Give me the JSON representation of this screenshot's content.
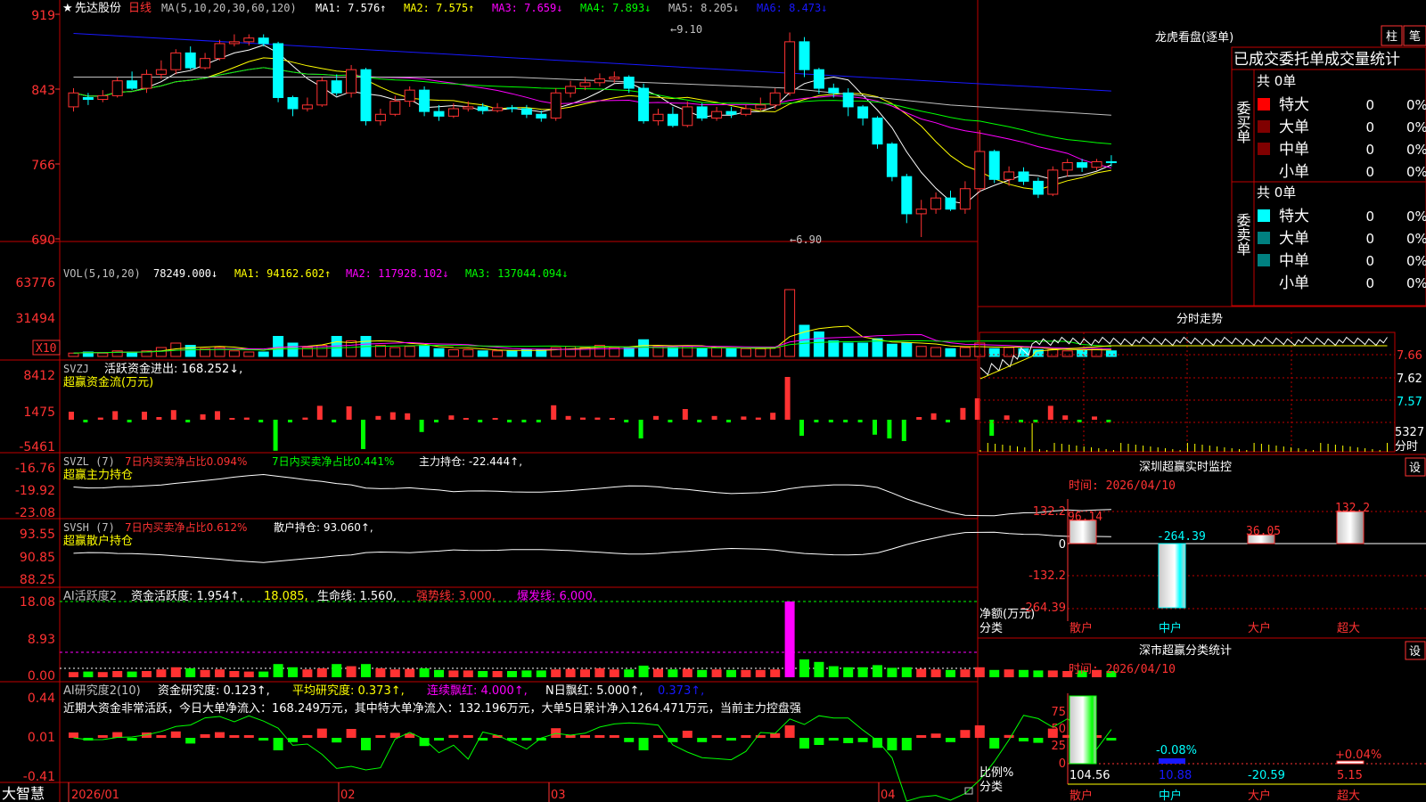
{
  "colors": {
    "up": "#ff3232",
    "down": "#00ffff",
    "ma1": "#ffffff",
    "ma2": "#ffff00",
    "ma3": "#ff00ff",
    "ma4": "#00ff00",
    "ma5": "#c0c0c0",
    "ma6": "#1818ff",
    "grid": "#c00000",
    "label": "#ff3232",
    "white": "#ffffff",
    "yellow": "#ffff00"
  },
  "main_header": {
    "star": "★",
    "stock": "先达股份",
    "period": "日线",
    "ma_params": "MA(5,10,20,30,60,120)",
    "ma1": "MA1: 7.576↑",
    "ma2": "MA2: 7.575↑",
    "ma3": "MA3: 7.659↓",
    "ma4": "MA4: 7.893↓",
    "ma5": "MA5: 8.205↓",
    "ma6": "MA6: 8.473↓"
  },
  "price_axis": [
    "919",
    "843",
    "766",
    "690"
  ],
  "annotations": {
    "high": "9.10",
    "low": "6.90"
  },
  "vol_header": {
    "name": "VOL(5,10,20)",
    "value": "78249.000↓",
    "ma1": "MA1: 94162.602↑",
    "ma2": "MA2: 117928.102↓",
    "ma3": "MA3: 137044.094↓"
  },
  "vol_axis": [
    "63776",
    "31494"
  ],
  "vol_unit": "X10",
  "svzj": {
    "name": "SVZJ",
    "label": "活跃资金进出: 168.252↓,",
    "sub": "超赢资金流(万元)",
    "axis": [
      "8412",
      "1475",
      "-5461"
    ]
  },
  "svzl": {
    "name": "SVZL (7)",
    "t1": "7日内买卖净占比0.094%",
    "t2": "7日内买卖净占比0.441%",
    "t3": "主力持仓: -22.444↑,",
    "sub": "超赢主力持仓",
    "axis": [
      "-16.76",
      "-19.92",
      "-23.08"
    ]
  },
  "svsh": {
    "name": "SVSH (7)",
    "t1": "7日内买卖净占比0.612%",
    "t2": "散户持仓: 93.060↑,",
    "sub": "超赢散户持仓",
    "axis": [
      "93.55",
      "90.85",
      "88.25"
    ]
  },
  "ai1": {
    "name": "AI活跃度2",
    "t1": "资金活跃度: 1.954↑,",
    "t2": "18.085,",
    "t3": "生命线: 1.560,",
    "t4": "强势线: 3.000,",
    "t5": "爆发线: 6.000,",
    "axis": [
      "18.08",
      "8.93",
      "0.00"
    ]
  },
  "ai2": {
    "name": "AI研究度2(10)",
    "t1": "资金研究度: 0.123↑,",
    "t2": "平均研究度: 0.373↑,",
    "t3": "连续飘红: 4.000↑,",
    "t4": "N日飘红: 5.000↑,",
    "t5": "0.373↑,",
    "msg": "近期大资金非常活跃，今日大单净流入：168.249万元，其中特大单净流入：132.196万元，大单5日累计净入1264.471万元，当前主力控盘强",
    "axis": [
      "0.44",
      "0.01",
      "-0.41"
    ]
  },
  "date_axis": [
    "2026/01",
    "02",
    "03",
    "04"
  ],
  "brand": "大智慧",
  "right": {
    "title": "龙虎看盘(逐单)",
    "btn_zhu": "柱",
    "btn_bi": "笔",
    "sub": "已成交委托单成交量统计",
    "buy_side": "委买单",
    "sell_side": "委卖单",
    "buy_total": "共 0单",
    "sell_total": "共 0单",
    "buy_rows": [
      {
        "name": "特大",
        "val": "0",
        "pct": "0%"
      },
      {
        "name": "大单",
        "val": "0",
        "pct": "0%"
      },
      {
        "name": "中单",
        "val": "0",
        "pct": "0%"
      },
      {
        "name": "小单",
        "val": "0",
        "pct": "0%"
      }
    ],
    "sell_rows": [
      {
        "name": "特大",
        "val": "0",
        "pct": "0%"
      },
      {
        "name": "大单",
        "val": "0",
        "pct": "0%"
      },
      {
        "name": "中单",
        "val": "0",
        "pct": "0%"
      },
      {
        "name": "小单",
        "val": "0",
        "pct": "0%"
      }
    ],
    "fenshi_title": "分时走势",
    "fenshi_axis": [
      "7.66",
      "7.62",
      "7.57"
    ],
    "fenshi_vol": "5327",
    "fenshi_label": "分时",
    "mon_title": "深圳超赢实时监控",
    "mon_btn": "设",
    "mon_time": "时间: 2026/04/10",
    "mon_axis": [
      "132.2",
      "0",
      "-132.2",
      "-264.39"
    ],
    "mon_vals": [
      "96.14",
      "-264.39",
      "36.05",
      "132.2"
    ],
    "mon_ylabel": "净额(万元)",
    "mon_xlabel": "分类",
    "cats": [
      "散户",
      "中户",
      "大户",
      "超大"
    ],
    "cls_title": "深市超赢分类统计",
    "cls_btn": "设",
    "cls_time": "时间: 2026/04/10",
    "cls_axis": [
      "75",
      "50",
      "25",
      "0"
    ],
    "cls_small": [
      "",
      "-0.08%",
      "",
      "+0.04%"
    ],
    "cls_vals": [
      "104.56",
      "10.88",
      "-20.59",
      "5.15"
    ],
    "cls_ylabel": "比例%",
    "cls_xlabel": "分类"
  },
  "chart_data": {
    "type": "candlestick",
    "title": "先达股份 日线",
    "ylim": [
      6.9,
      9.2
    ],
    "x_labels": [
      "2026/01",
      "02",
      "03",
      "04"
    ],
    "candles": [
      [
        8.3,
        8.45,
        8.5,
        8.25
      ],
      [
        8.4,
        8.38,
        8.45,
        8.32
      ],
      [
        8.38,
        8.42,
        8.48,
        8.35
      ],
      [
        8.42,
        8.58,
        8.62,
        8.4
      ],
      [
        8.58,
        8.5,
        8.68,
        8.48
      ],
      [
        8.5,
        8.65,
        8.7,
        8.45
      ],
      [
        8.65,
        8.7,
        8.8,
        8.6
      ],
      [
        8.7,
        8.88,
        8.92,
        8.65
      ],
      [
        8.88,
        8.72,
        8.95,
        8.7
      ],
      [
        8.72,
        8.82,
        8.88,
        8.7
      ],
      [
        8.82,
        8.98,
        9.02,
        8.8
      ],
      [
        8.98,
        9.0,
        9.08,
        8.95
      ],
      [
        9.0,
        9.04,
        9.08,
        8.96
      ],
      [
        9.04,
        8.98,
        9.08,
        8.95
      ],
      [
        8.98,
        8.4,
        9.0,
        8.35
      ],
      [
        8.4,
        8.28,
        8.42,
        8.2
      ],
      [
        8.28,
        8.32,
        8.4,
        8.25
      ],
      [
        8.32,
        8.58,
        8.62,
        8.3
      ],
      [
        8.58,
        8.45,
        8.65,
        8.42
      ],
      [
        8.45,
        8.7,
        8.75,
        8.4
      ],
      [
        8.7,
        8.15,
        8.72,
        8.1
      ],
      [
        8.15,
        8.22,
        8.28,
        8.1
      ],
      [
        8.22,
        8.36,
        8.42,
        8.2
      ],
      [
        8.36,
        8.48,
        8.52,
        8.3
      ],
      [
        8.48,
        8.25,
        8.52,
        8.2
      ],
      [
        8.25,
        8.2,
        8.32,
        8.15
      ],
      [
        8.2,
        8.28,
        8.34,
        8.18
      ],
      [
        8.28,
        8.3,
        8.36,
        8.25
      ],
      [
        8.3,
        8.26,
        8.34,
        8.22
      ],
      [
        8.26,
        8.29,
        8.34,
        8.24
      ],
      [
        8.29,
        8.28,
        8.32,
        8.24
      ],
      [
        8.28,
        8.22,
        8.32,
        8.18
      ],
      [
        8.22,
        8.18,
        8.26,
        8.14
      ],
      [
        8.18,
        8.45,
        8.5,
        8.15
      ],
      [
        8.45,
        8.52,
        8.58,
        8.4
      ],
      [
        8.52,
        8.56,
        8.62,
        8.48
      ],
      [
        8.56,
        8.6,
        8.66,
        8.52
      ],
      [
        8.6,
        8.62,
        8.68,
        8.56
      ],
      [
        8.62,
        8.5,
        8.64,
        8.45
      ],
      [
        8.5,
        8.15,
        8.55,
        8.12
      ],
      [
        8.15,
        8.22,
        8.28,
        8.1
      ],
      [
        8.22,
        8.1,
        8.3,
        8.08
      ],
      [
        8.1,
        8.3,
        8.36,
        8.08
      ],
      [
        8.3,
        8.18,
        8.34,
        8.15
      ],
      [
        8.18,
        8.25,
        8.3,
        8.15
      ],
      [
        8.25,
        8.22,
        8.3,
        8.18
      ],
      [
        8.22,
        8.28,
        8.32,
        8.2
      ],
      [
        8.28,
        8.32,
        8.4,
        8.26
      ],
      [
        8.32,
        8.45,
        8.5,
        8.28
      ],
      [
        8.45,
        9.0,
        9.1,
        8.42
      ],
      [
        9.0,
        8.7,
        9.05,
        8.62
      ],
      [
        8.7,
        8.5,
        8.72,
        8.44
      ],
      [
        8.5,
        8.45,
        8.55,
        8.4
      ],
      [
        8.45,
        8.3,
        8.5,
        8.2
      ],
      [
        8.3,
        8.18,
        8.32,
        8.1
      ],
      [
        8.18,
        7.9,
        8.2,
        7.85
      ],
      [
        7.9,
        7.55,
        7.92,
        7.5
      ],
      [
        7.55,
        7.15,
        7.58,
        7.05
      ],
      [
        7.15,
        7.2,
        7.3,
        6.9
      ],
      [
        7.2,
        7.32,
        7.38,
        7.15
      ],
      [
        7.32,
        7.2,
        7.4,
        7.18
      ],
      [
        7.2,
        7.42,
        7.5,
        7.15
      ],
      [
        7.42,
        7.82,
        8.05,
        7.38
      ],
      [
        7.82,
        7.52,
        7.84,
        7.48
      ],
      [
        7.52,
        7.6,
        7.66,
        7.45
      ],
      [
        7.6,
        7.5,
        7.65,
        7.46
      ],
      [
        7.5,
        7.36,
        7.54,
        7.32
      ],
      [
        7.36,
        7.62,
        7.66,
        7.34
      ],
      [
        7.62,
        7.7,
        7.74,
        7.55
      ],
      [
        7.7,
        7.65,
        7.74,
        7.6
      ],
      [
        7.65,
        7.71,
        7.74,
        7.62
      ],
      [
        7.71,
        7.7,
        7.78,
        7.66
      ]
    ],
    "volume_ylim": [
      0,
      63776
    ],
    "volume": [
      3,
      4,
      3,
      5,
      4,
      5,
      8,
      12,
      10,
      7,
      8,
      5,
      4,
      4,
      18,
      12,
      8,
      10,
      18,
      14,
      18,
      10,
      8,
      9,
      10,
      7,
      6,
      6,
      5,
      5,
      5,
      6,
      6,
      8,
      9,
      8,
      10,
      8,
      8,
      15,
      9,
      8,
      9,
      7,
      8,
      7,
      7,
      7,
      8,
      60,
      28,
      22,
      14,
      12,
      12,
      16,
      11,
      12,
      9,
      8,
      7,
      8,
      12,
      7,
      8,
      7,
      6,
      6,
      5,
      6,
      7,
      5
    ]
  }
}
